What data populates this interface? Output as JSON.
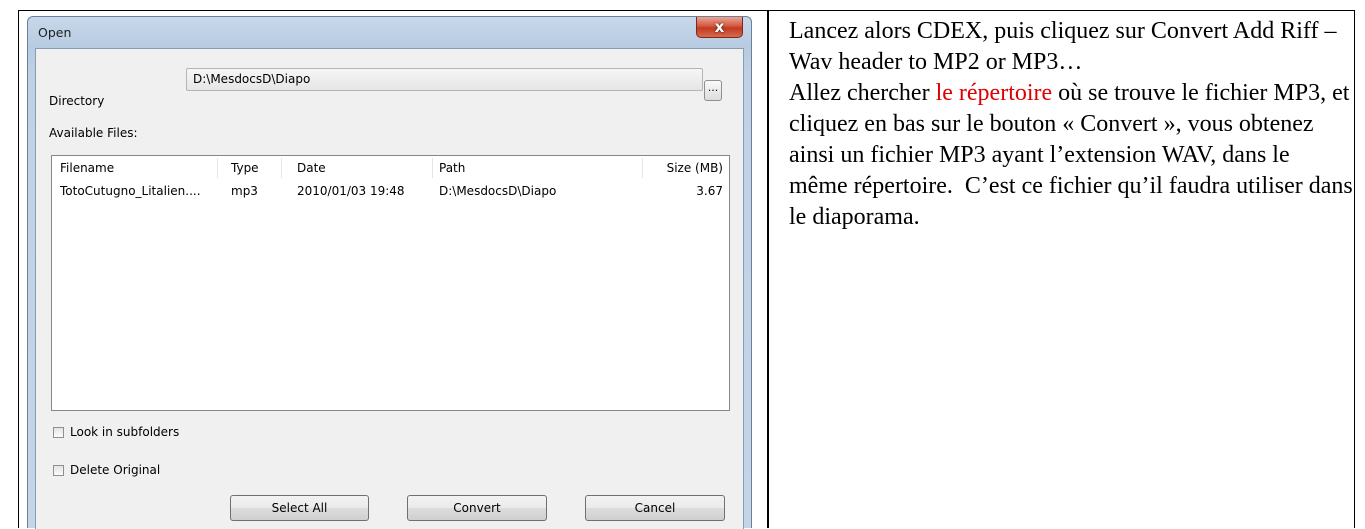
{
  "dialog": {
    "title": "Open",
    "close_symbol": "x",
    "directory_label": "Directory",
    "directory_value": "D:\\MesdocsD\\Diapo",
    "browse_label": "...",
    "available_files_label": "Available Files:",
    "columns": [
      "Filename",
      "Type",
      "Date",
      "Path",
      "Size (MB)"
    ],
    "rows": [
      [
        "TotoCutugno_Litalien....",
        "mp3",
        "2010/01/03 19:48",
        "D:\\MesdocsD\\Diapo",
        "3.67"
      ]
    ],
    "look_in_subfolders_label": "Look in subfolders",
    "look_in_subfolders_checked": false,
    "delete_original_label": "Delete Original",
    "delete_original_checked": false,
    "select_all_label": "Select All",
    "convert_label": "Convert",
    "cancel_label": "Cancel"
  },
  "instructions": {
    "line1": "Lancez alors CDEX, puis cliquez sur Convert Add Riff –Wav header to MP2 or MP3…",
    "line2_before": "Allez chercher ",
    "line2_highlight": "le répertoire",
    "line2_after": " où se trouve le fichier MP3, et cliquez en bas sur le bouton « Convert », vous obtenez ainsi un fichier MP3 ayant l’extension WAV, dans le même répertoire.  C’est ce fichier qu’il faudra utiliser dans le diaporama.",
    "highlight_color": "#e00000"
  }
}
